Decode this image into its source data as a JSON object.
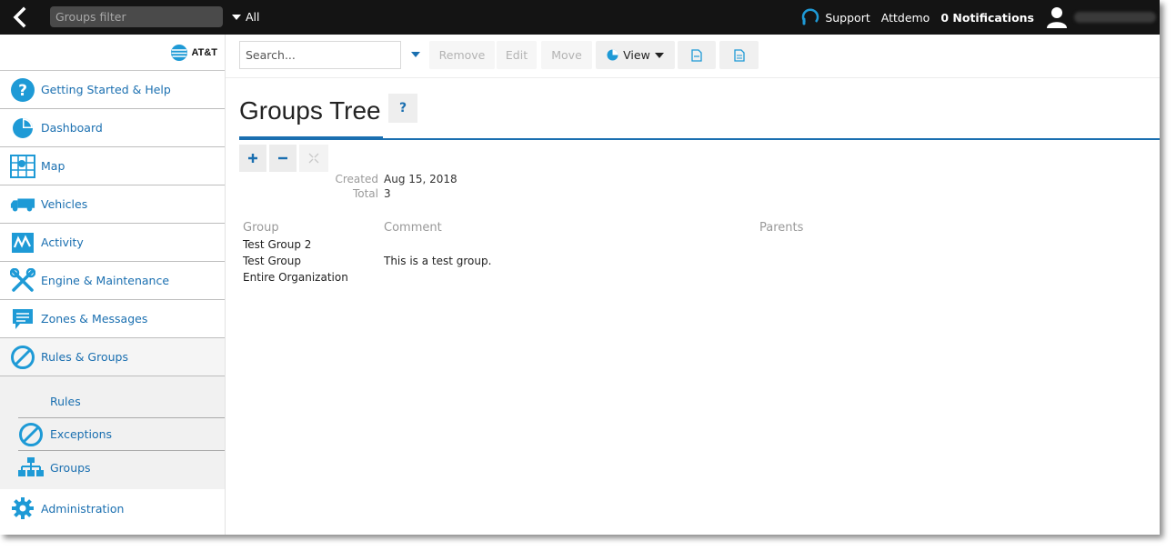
{
  "topbar": {
    "filter_placeholder": "Groups filter",
    "filter_scope": "All",
    "support_label": "Support",
    "user_label": "Attdemo",
    "notifications_label": "0 Notifications"
  },
  "sidebar": {
    "brand": "AT&T",
    "items": [
      {
        "label": "Getting Started & Help",
        "icon": "help-icon"
      },
      {
        "label": "Dashboard",
        "icon": "pie-chart-icon"
      },
      {
        "label": "Map",
        "icon": "map-icon"
      },
      {
        "label": "Vehicles",
        "icon": "truck-icon"
      },
      {
        "label": "Activity",
        "icon": "activity-icon"
      },
      {
        "label": "Engine & Maintenance",
        "icon": "tools-icon"
      },
      {
        "label": "Zones & Messages",
        "icon": "message-icon"
      },
      {
        "label": "Rules & Groups",
        "icon": "prohibited-icon"
      }
    ],
    "subitems": [
      {
        "label": "Rules"
      },
      {
        "label": "Exceptions",
        "icon": "prohibited-icon"
      },
      {
        "label": "Groups",
        "icon": "hierarchy-icon"
      }
    ],
    "admin": {
      "label": "Administration",
      "icon": "gear-icon"
    }
  },
  "toolbar": {
    "search_placeholder": "Search...",
    "remove_label": "Remove",
    "edit_label": "Edit",
    "move_label": "Move",
    "view_label": "View"
  },
  "page": {
    "title": "Groups Tree",
    "help_label": "?",
    "created_key": "Created",
    "created_val": "Aug 15, 2018",
    "total_key": "Total",
    "total_val": "3"
  },
  "grid": {
    "headers": {
      "group": "Group",
      "comment": "Comment",
      "parents": "Parents"
    },
    "rows": [
      {
        "group": "Test Group 2",
        "comment": "",
        "parents": ""
      },
      {
        "group": "Test Group",
        "comment": "This is a test group.",
        "parents": ""
      },
      {
        "group": "Entire Organization",
        "comment": "",
        "parents": ""
      }
    ]
  },
  "colors": {
    "accent": "#1a6fb0",
    "topbar": "#141414",
    "icon_blue": "#1e9ad6"
  }
}
